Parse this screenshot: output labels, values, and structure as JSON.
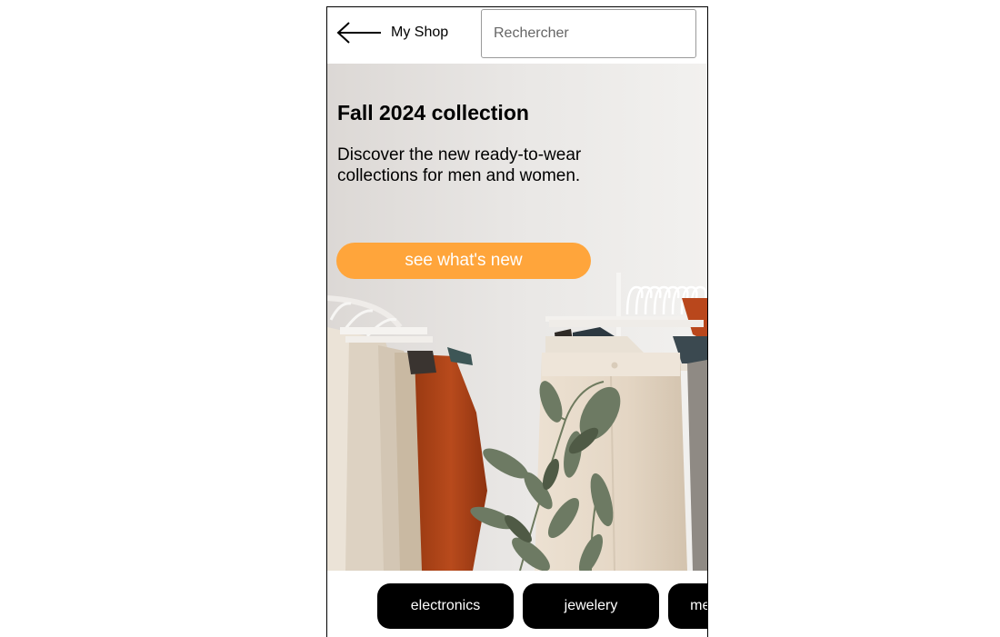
{
  "header": {
    "back_icon": "arrow-left-icon",
    "title": "My Shop",
    "search_placeholder": "Rechercher"
  },
  "hero": {
    "title": "Fall 2024 collection",
    "description": "Discover the new ready-to-wear collections for men and women.",
    "cta_label": "see what's new",
    "accent_color": "#ffa53b"
  },
  "categories": [
    {
      "label": "electronics"
    },
    {
      "label": "jewelery"
    },
    {
      "label": "men's clothing"
    }
  ]
}
